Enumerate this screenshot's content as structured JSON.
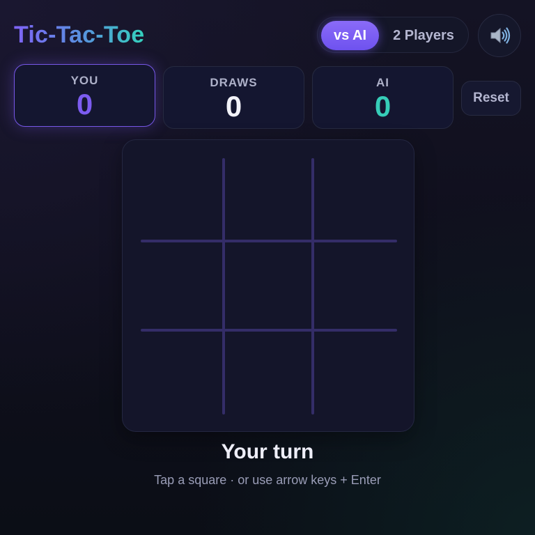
{
  "header": {
    "title": "Tic-Tac-Toe",
    "modes": [
      {
        "label": "vs AI",
        "active": true
      },
      {
        "label": "2 Players",
        "active": false
      }
    ],
    "sound_icon": "speaker-icon"
  },
  "scores": {
    "you": {
      "label": "YOU",
      "value": "0",
      "color": "#7c5cf0"
    },
    "draws": {
      "label": "DRAWS",
      "value": "0",
      "color": "#f2f2f8"
    },
    "ai": {
      "label": "AI",
      "value": "0",
      "color": "#36cdb8"
    }
  },
  "reset_label": "Reset",
  "board": {
    "cells": [
      "",
      "",
      "",
      "",
      "",
      "",
      "",
      "",
      ""
    ]
  },
  "status": "Your turn",
  "hint": "Tap a square · or use arrow keys + Enter"
}
